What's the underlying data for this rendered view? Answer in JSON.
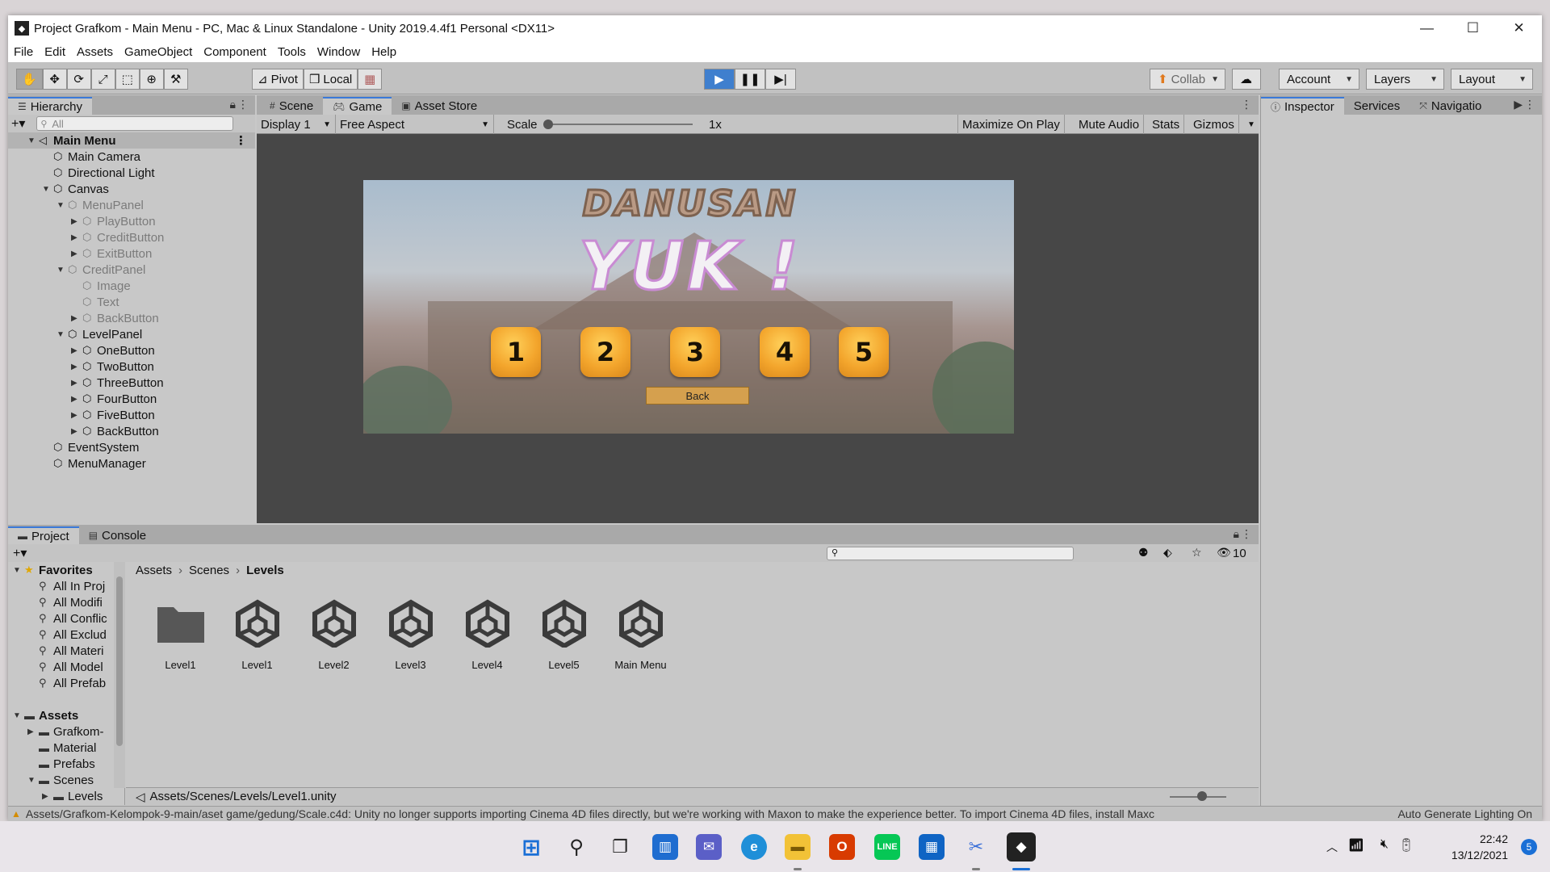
{
  "window": {
    "title": "Project Grafkom - Main Menu - PC, Mac & Linux Standalone - Unity 2019.4.4f1 Personal <DX11>",
    "controls": {
      "minimize": "—",
      "maximize": "☐",
      "close": "✕"
    }
  },
  "menu": [
    "File",
    "Edit",
    "Assets",
    "GameObject",
    "Component",
    "Tools",
    "Window",
    "Help"
  ],
  "toolbar": {
    "tools": [
      "hand-icon",
      "move-icon",
      "rotate-icon",
      "scale-icon",
      "rect-icon",
      "transform-icon",
      "custom-tool-icon"
    ],
    "pivot_label": "Pivot",
    "local_label": "Local",
    "collab_label": "Collab",
    "account_label": "Account",
    "layers_label": "Layers",
    "layout_label": "Layout"
  },
  "hierarchy": {
    "tab": "Hierarchy",
    "search_placeholder": "All",
    "items": [
      {
        "label": "Main Menu",
        "depth": 0,
        "arrow": "▼",
        "kind": "scene",
        "dim": false
      },
      {
        "label": "Main Camera",
        "depth": 1,
        "arrow": "",
        "dim": false
      },
      {
        "label": "Directional Light",
        "depth": 1,
        "arrow": "",
        "dim": false
      },
      {
        "label": "Canvas",
        "depth": 1,
        "arrow": "▼",
        "dim": false
      },
      {
        "label": "MenuPanel",
        "depth": 2,
        "arrow": "▼",
        "dim": true
      },
      {
        "label": "PlayButton",
        "depth": 3,
        "arrow": "▶",
        "dim": true
      },
      {
        "label": "CreditButton",
        "depth": 3,
        "arrow": "▶",
        "dim": true
      },
      {
        "label": "ExitButton",
        "depth": 3,
        "arrow": "▶",
        "dim": true
      },
      {
        "label": "CreditPanel",
        "depth": 2,
        "arrow": "▼",
        "dim": true
      },
      {
        "label": "Image",
        "depth": 3,
        "arrow": "",
        "dim": true
      },
      {
        "label": "Text",
        "depth": 3,
        "arrow": "",
        "dim": true
      },
      {
        "label": "BackButton",
        "depth": 3,
        "arrow": "▶",
        "dim": true
      },
      {
        "label": "LevelPanel",
        "depth": 2,
        "arrow": "▼",
        "dim": false
      },
      {
        "label": "OneButton",
        "depth": 3,
        "arrow": "▶",
        "dim": false
      },
      {
        "label": "TwoButton",
        "depth": 3,
        "arrow": "▶",
        "dim": false
      },
      {
        "label": "ThreeButton",
        "depth": 3,
        "arrow": "▶",
        "dim": false
      },
      {
        "label": "FourButton",
        "depth": 3,
        "arrow": "▶",
        "dim": false
      },
      {
        "label": "FiveButton",
        "depth": 3,
        "arrow": "▶",
        "dim": false
      },
      {
        "label": "BackButton",
        "depth": 3,
        "arrow": "▶",
        "dim": false
      },
      {
        "label": "EventSystem",
        "depth": 1,
        "arrow": "",
        "dim": false
      },
      {
        "label": "MenuManager",
        "depth": 1,
        "arrow": "",
        "dim": false
      }
    ]
  },
  "center_tabs": {
    "scene": "Scene",
    "game": "Game",
    "asset_store": "Asset Store"
  },
  "game_controls": {
    "display": "Display 1",
    "aspect": "Free Aspect",
    "scale_label": "Scale",
    "scale_value": "1x",
    "maximize": "Maximize On Play",
    "mute": "Mute Audio",
    "stats": "Stats",
    "gizmos": "Gizmos"
  },
  "game": {
    "title_line1": "DANUSAN",
    "title_line2": "YUK !",
    "level_buttons": [
      "1",
      "2",
      "3",
      "4",
      "5"
    ],
    "back_label": "Back"
  },
  "inspector_tabs": {
    "inspector": "Inspector",
    "services": "Services",
    "navigation": "Navigatio"
  },
  "project": {
    "tabs": {
      "project": "Project",
      "console": "Console"
    },
    "hidden_count": "10",
    "tree": [
      {
        "label": "Favorites",
        "arrow": "▼",
        "icon": "★",
        "bold": true,
        "indent": 0
      },
      {
        "label": "All In Proj",
        "arrow": "",
        "icon": "⚲",
        "bold": false,
        "indent": 1
      },
      {
        "label": "All Modifi",
        "arrow": "",
        "icon": "⚲",
        "bold": false,
        "indent": 1
      },
      {
        "label": "All Conflic",
        "arrow": "",
        "icon": "⚲",
        "bold": false,
        "indent": 1
      },
      {
        "label": "All Exclud",
        "arrow": "",
        "icon": "⚲",
        "bold": false,
        "indent": 1
      },
      {
        "label": "All Materi",
        "arrow": "",
        "icon": "⚲",
        "bold": false,
        "indent": 1
      },
      {
        "label": "All Model",
        "arrow": "",
        "icon": "⚲",
        "bold": false,
        "indent": 1
      },
      {
        "label": "All Prefab",
        "arrow": "",
        "icon": "⚲",
        "bold": false,
        "indent": 1
      },
      {
        "label": "",
        "arrow": "",
        "icon": "",
        "bold": false,
        "indent": 0
      },
      {
        "label": "Assets",
        "arrow": "▼",
        "icon": "▬",
        "bold": true,
        "indent": 0
      },
      {
        "label": "Grafkom-",
        "arrow": "▶",
        "icon": "▬",
        "bold": false,
        "indent": 1
      },
      {
        "label": "Material",
        "arrow": "",
        "icon": "▬",
        "bold": false,
        "indent": 1
      },
      {
        "label": "Prefabs",
        "arrow": "",
        "icon": "▬",
        "bold": false,
        "indent": 1
      },
      {
        "label": "Scenes",
        "arrow": "▼",
        "icon": "▬",
        "bold": false,
        "indent": 1
      },
      {
        "label": "Levels",
        "arrow": "▶",
        "icon": "▬",
        "bold": false,
        "indent": 2
      }
    ],
    "breadcrumb": [
      "Assets",
      "Scenes",
      "Levels"
    ],
    "assets": [
      {
        "label": "Level1",
        "kind": "folder"
      },
      {
        "label": "Level1",
        "kind": "scene"
      },
      {
        "label": "Level2",
        "kind": "scene"
      },
      {
        "label": "Level3",
        "kind": "scene"
      },
      {
        "label": "Level4",
        "kind": "scene"
      },
      {
        "label": "Level5",
        "kind": "scene"
      },
      {
        "label": "Main Menu",
        "kind": "scene"
      }
    ],
    "selected_path": "Assets/Scenes/Levels/Level1.unity"
  },
  "status": {
    "message": "Assets/Grafkom-Kelompok-9-main/aset game/gedung/Scale.c4d: Unity no longer supports importing Cinema 4D files directly, but we're working with Maxon to make the experience better. To import Cinema 4D files, install Maxc",
    "right": "Auto Generate Lighting On"
  },
  "taskbar": {
    "apps": [
      "windows-start-icon",
      "search-icon",
      "task-view-icon",
      "widgets-icon",
      "teams-chat-icon",
      "edge-icon",
      "file-explorer-icon",
      "office-icon",
      "line-icon",
      "store-icon",
      "snipping-tool-icon",
      "unity-icon"
    ],
    "time": "22:42",
    "date": "13/12/2021",
    "notifications": "5"
  },
  "colors": {
    "accent": "#3a79d8",
    "play_active": "#3f7fce",
    "level_button": "#f3a52c"
  }
}
